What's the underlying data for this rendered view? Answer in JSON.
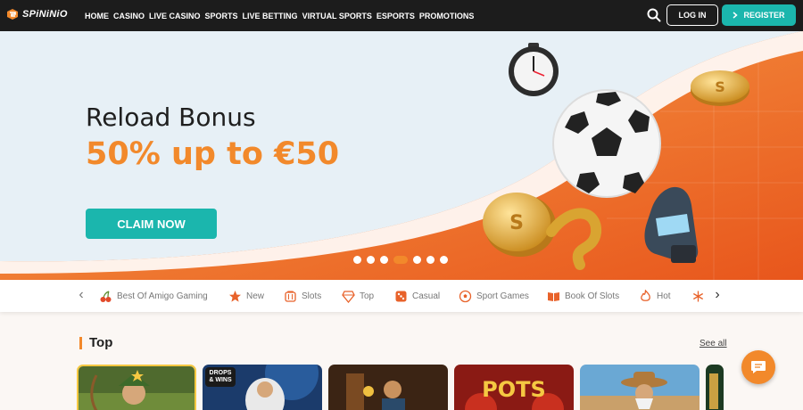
{
  "brand": {
    "name": "SPiNiNiO",
    "accent": "#f2892b",
    "teal": "#1bb6ad"
  },
  "nav": {
    "items": [
      "HOME",
      "CASINO",
      "LIVE CASINO",
      "SPORTS",
      "LIVE BETTING",
      "VIRTUAL SPORTS",
      "ESPORTS",
      "PROMOTIONS"
    ],
    "login_label": "LOG IN",
    "register_label": "REGISTER",
    "search_icon": "search-icon"
  },
  "hero": {
    "title": "Reload Bonus",
    "subtitle": "50% up to €50",
    "cta_label": "CLAIM NOW",
    "slide_count": 7,
    "active_slide": 4
  },
  "categories": [
    {
      "label": "Best Of Amigo Gaming",
      "icon": "cherries-icon"
    },
    {
      "label": "New",
      "icon": "star-icon"
    },
    {
      "label": "Slots",
      "icon": "slot-machine-icon"
    },
    {
      "label": "Top",
      "icon": "diamond-icon"
    },
    {
      "label": "Casual",
      "icon": "dice-icon"
    },
    {
      "label": "Sport Games",
      "icon": "soccer-ball-icon"
    },
    {
      "label": "Book Of Slots",
      "icon": "book-icon"
    },
    {
      "label": "Hot",
      "icon": "flame-icon"
    },
    {
      "label": "",
      "icon": "snowflake-icon"
    }
  ],
  "top_section": {
    "title": "Top",
    "see_all_label": "See all",
    "tile_badge": "DROPS & WINS",
    "tile_pots_label": "POTS"
  },
  "chat_icon": "chat-bubble-icon"
}
